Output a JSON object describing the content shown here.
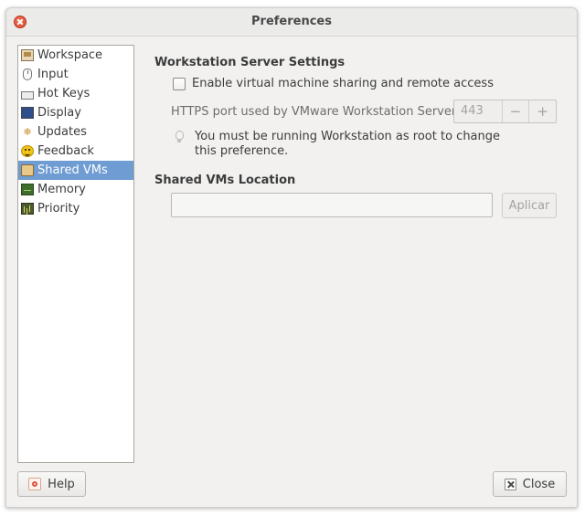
{
  "window": {
    "title": "Preferences"
  },
  "sidebar": {
    "items": [
      {
        "label": "Workspace",
        "icon": "workspace-icon"
      },
      {
        "label": "Input",
        "icon": "mouse-icon"
      },
      {
        "label": "Hot Keys",
        "icon": "keyboard-icon"
      },
      {
        "label": "Display",
        "icon": "monitor-icon"
      },
      {
        "label": "Updates",
        "icon": "updates-icon"
      },
      {
        "label": "Feedback",
        "icon": "smiley-icon"
      },
      {
        "label": "Shared VMs",
        "icon": "shared-vms-icon",
        "selected": true
      },
      {
        "label": "Memory",
        "icon": "memory-icon"
      },
      {
        "label": "Priority",
        "icon": "priority-icon"
      }
    ]
  },
  "main": {
    "server_heading": "Workstation Server Settings",
    "enable_sharing_label": "Enable virtual machine sharing and remote access",
    "enable_sharing_checked": false,
    "port_label": "HTTPS port used by VMware Workstation Server:",
    "port_value": "443",
    "decrement_symbol": "−",
    "increment_symbol": "+",
    "hint_text": "You must be running Workstation as root to change this preference.",
    "location_heading": "Shared VMs Location",
    "location_value": "",
    "apply_label": "Aplicar"
  },
  "footer": {
    "help_label": "Help",
    "close_label": "Close"
  },
  "colors": {
    "selection": "#6f9cd2",
    "window_bg": "#f2f1f0",
    "close_button": "#d9452b"
  }
}
